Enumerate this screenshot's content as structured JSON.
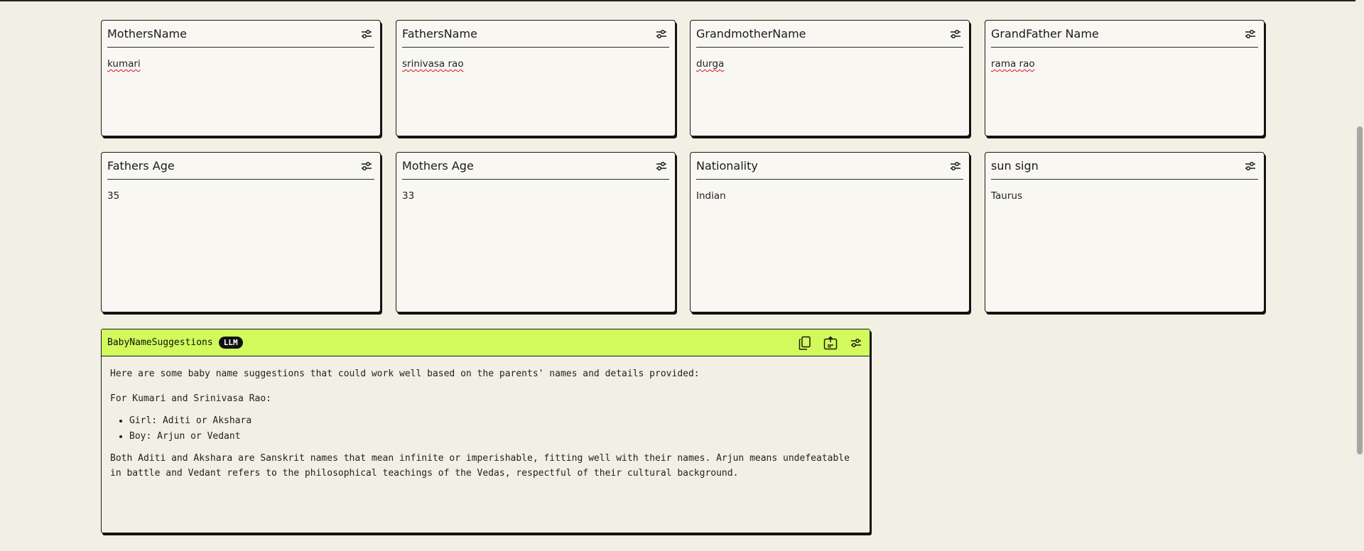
{
  "fields": [
    {
      "title": "MothersName",
      "value": "kumari"
    },
    {
      "title": "FathersName",
      "value": "srinivasa rao"
    },
    {
      "title": "GrandmotherName",
      "value": "durga"
    },
    {
      "title": "GrandFather Name",
      "value": "rama rao"
    },
    {
      "title": "Fathers Age",
      "value": "35"
    },
    {
      "title": "Mothers Age",
      "value": "33"
    },
    {
      "title": "Nationality",
      "value": "Indian"
    },
    {
      "title": "sun sign",
      "value": "Taurus"
    }
  ],
  "llm_card": {
    "title": "BabyNameSuggestions",
    "badge": "LLM",
    "intro": "Here are some baby name suggestions that could work well based on the parents' names and details provided:",
    "for_line": "For Kumari and Srinivasa Rao:",
    "bullets": [
      "Girl: Aditi or Akshara",
      "Boy: Arjun or Vedant"
    ],
    "conclusion": "Both Aditi and Akshara are Sanskrit names that mean infinite or imperishable, fitting well with their names. Arjun means undefeatable in battle and Vedant refers to the philosophical teachings of the Vedas, respectful of their cultural background."
  },
  "icons": {
    "settings": "sliders-icon",
    "copy": "copy-icon",
    "export": "export-icon"
  }
}
